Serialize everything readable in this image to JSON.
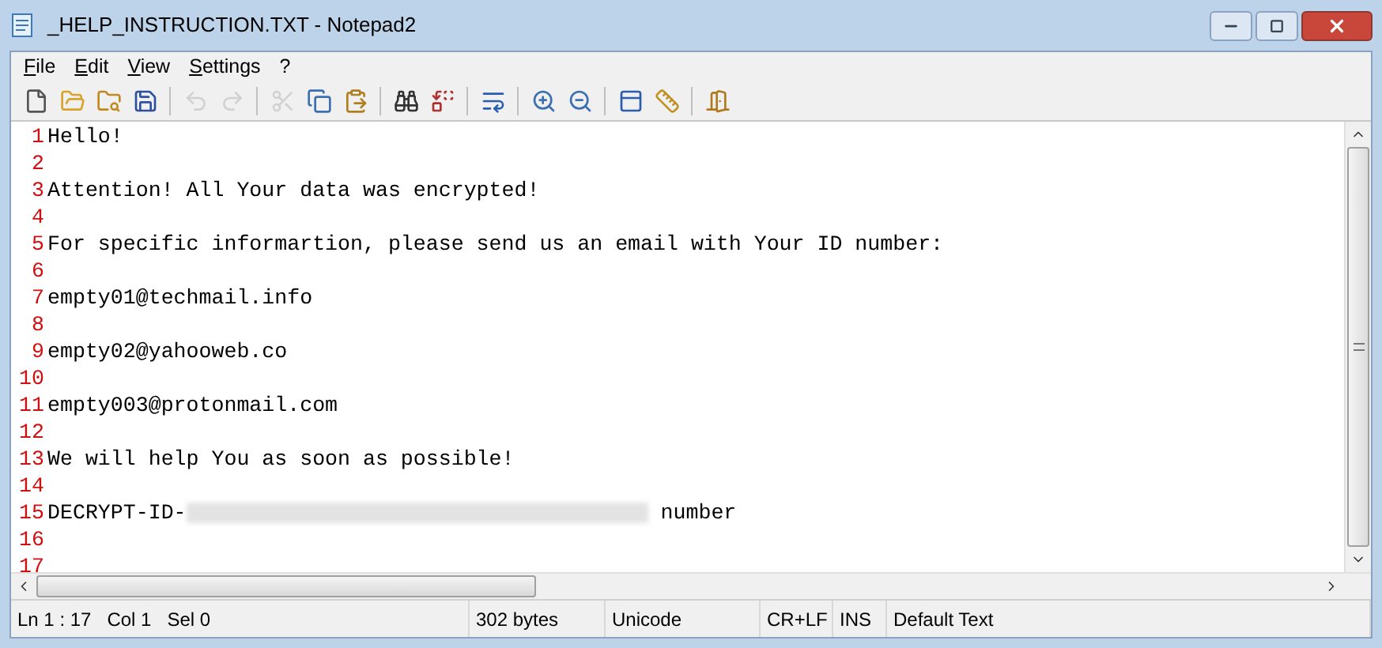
{
  "window": {
    "title": "_HELP_INSTRUCTION.TXT - Notepad2"
  },
  "menu": [
    {
      "label": "File"
    },
    {
      "label": "Edit"
    },
    {
      "label": "View"
    },
    {
      "label": "Settings"
    },
    {
      "label": "?"
    }
  ],
  "toolbar": [
    [
      {
        "kind": "new",
        "disabled": false
      },
      {
        "kind": "open",
        "disabled": false
      },
      {
        "kind": "browse",
        "disabled": false
      },
      {
        "kind": "save",
        "disabled": false
      }
    ],
    [
      {
        "kind": "undo",
        "disabled": true
      },
      {
        "kind": "redo",
        "disabled": true
      }
    ],
    [
      {
        "kind": "cut",
        "disabled": true
      },
      {
        "kind": "copy",
        "disabled": false
      },
      {
        "kind": "paste",
        "disabled": false
      }
    ],
    [
      {
        "kind": "find",
        "disabled": false
      },
      {
        "kind": "replace",
        "disabled": false
      }
    ],
    [
      {
        "kind": "wrap",
        "disabled": false
      }
    ],
    [
      {
        "kind": "zoom_in",
        "disabled": false
      },
      {
        "kind": "zoom_out",
        "disabled": false
      }
    ],
    [
      {
        "kind": "scheme",
        "disabled": false
      },
      {
        "kind": "customize",
        "disabled": false
      }
    ],
    [
      {
        "kind": "exit",
        "disabled": false
      }
    ]
  ],
  "lines": [
    {
      "number": "1",
      "text": "Hello!"
    },
    {
      "number": "2"
    },
    {
      "number": "3",
      "text": "Attention! All Your data was encrypted!"
    },
    {
      "number": "4"
    },
    {
      "number": "5",
      "text": "For specific informartion, please send us an email with Your ID number:"
    },
    {
      "number": "6"
    },
    {
      "number": "7",
      "text": "empty01@techmail.info"
    },
    {
      "number": "8"
    },
    {
      "number": "9",
      "text": "empty02@yahooweb.co"
    },
    {
      "number": "10"
    },
    {
      "number": "11",
      "text": "empty003@protonmail.com"
    },
    {
      "number": "12"
    },
    {
      "number": "13",
      "text": "We will help You as soon as possible!"
    },
    {
      "number": "14"
    },
    {
      "number": "15",
      "text": "DECRYPT-ID-",
      "redacted": true,
      "after": "number"
    },
    {
      "number": "16"
    },
    {
      "number": "17"
    }
  ],
  "status_bar": [
    "Ln 1 : 17   Col 1   Sel 0",
    "302 bytes",
    "Unicode",
    "CR+LF",
    "INS",
    "Default Text"
  ]
}
